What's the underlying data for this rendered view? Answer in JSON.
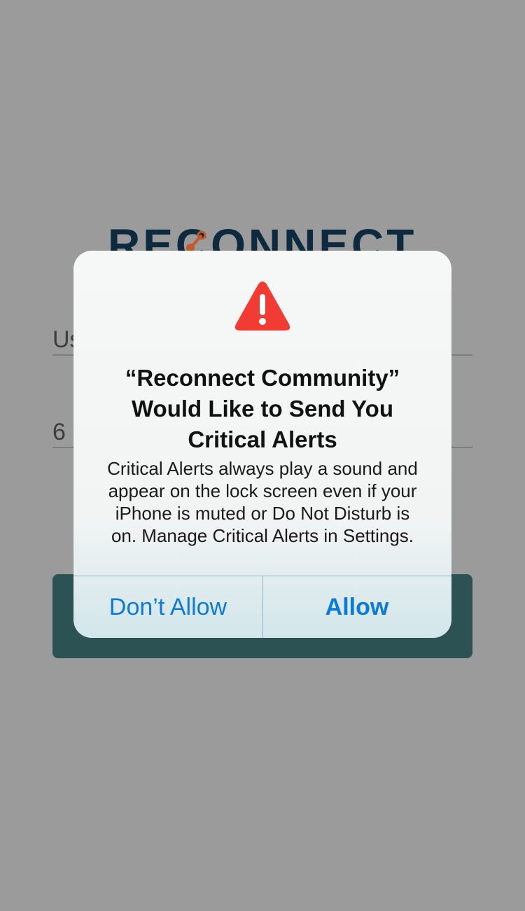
{
  "background": {
    "logo_text": "RECONNECT",
    "username_field_value": "Us",
    "password_field_value": "6",
    "colors": {
      "logo": "#0e2a3e",
      "logo_accent": "#c45a2c",
      "button": "#2d5254",
      "overlay": "#9b9b9b"
    }
  },
  "alert": {
    "icon": "warning-triangle-icon",
    "icon_color": "#f23b33",
    "title_lines": [
      "“Reconnect Community”",
      "Would Like to Send You",
      "Critical Alerts"
    ],
    "message_lines": [
      "Critical Alerts always play a sound and",
      "appear on the lock screen even if your",
      "iPhone is muted or Do Not Disturb is",
      "on. Manage Critical Alerts in Settings."
    ],
    "buttons": {
      "dont_allow": "Don’t Allow",
      "allow": "Allow"
    },
    "button_color": "#0a7bd8"
  }
}
